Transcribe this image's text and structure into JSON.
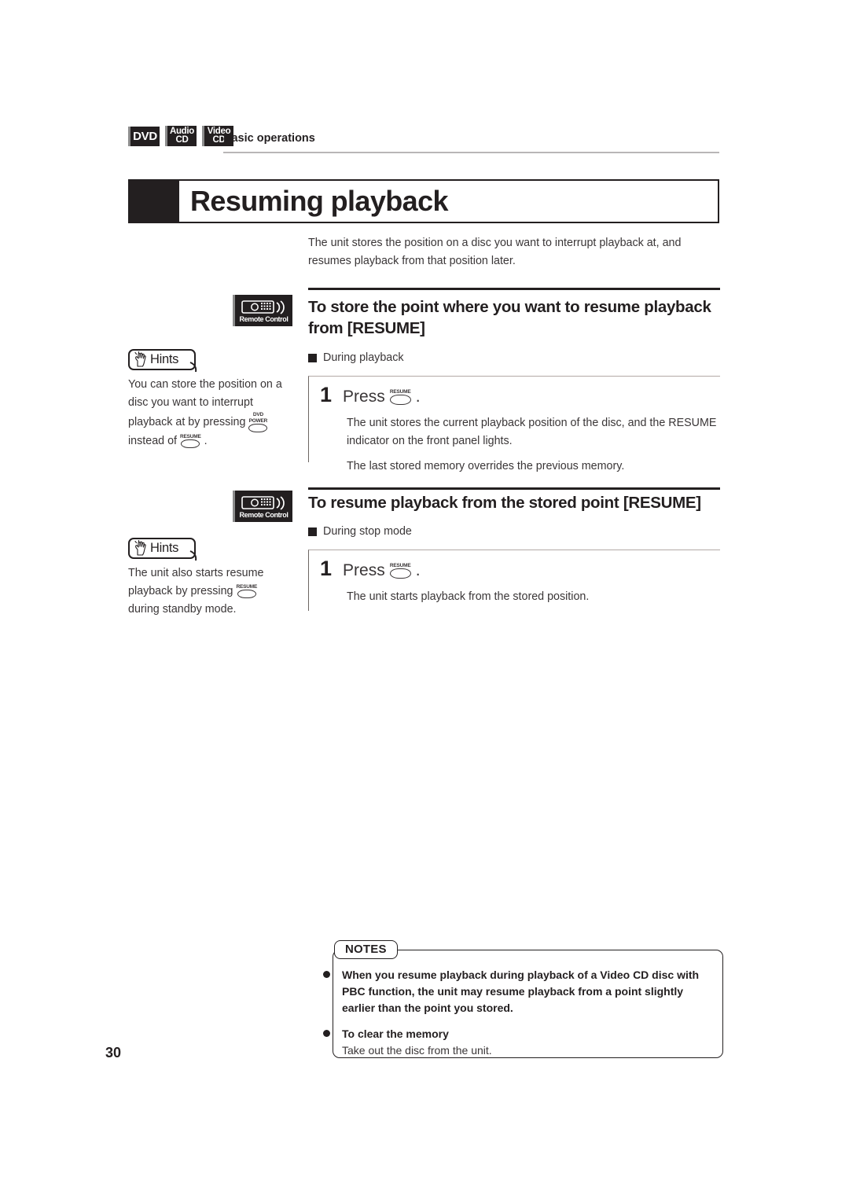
{
  "header": {
    "badges": [
      {
        "name": "dvd-badge",
        "line1": "DVD",
        "line2": ""
      },
      {
        "name": "audio-cd-badge",
        "line1": "Audio",
        "line2": "CD"
      },
      {
        "name": "video-cd-badge",
        "line1": "Video",
        "line2": "CD"
      }
    ],
    "title": "Basic operations"
  },
  "title_block": {
    "title": "Resuming playback"
  },
  "intro": "The unit stores the position on a disc you want to interrupt playback at, and resumes playback from that position later.",
  "sections": [
    {
      "icon_label": "Remote Control",
      "heading": "To store the point where you want to resume playback from [RESUME]",
      "mode": "During playback",
      "step": {
        "number": "1",
        "press_label": "Press",
        "button": "RESUME",
        "period": ".",
        "body": [
          "The unit stores the current playback position of the disc, and the RESUME indicator on the front panel lights.",
          "The last stored memory overrides the previous memory."
        ]
      },
      "hint": {
        "label": "Hints",
        "text_part1": "You can store the position on a disc you want to interrupt playback at by pressing",
        "button1_line1": "DVD",
        "button1_line2": "POWER",
        "text_part2": "instead of",
        "button2": "RESUME",
        "text_part3": "."
      }
    },
    {
      "icon_label": "Remote Control",
      "heading": "To resume playback from the stored point [RESUME]",
      "mode": "During stop mode",
      "step": {
        "number": "1",
        "press_label": "Press",
        "button": "RESUME",
        "period": ".",
        "body": [
          "The unit starts playback from the stored position."
        ]
      },
      "hint": {
        "label": "Hints",
        "text_part1": "The unit also starts resume playback by pressing",
        "button1_line1": "RESUME",
        "button1_line2": "",
        "text_part2": "during standby mode.",
        "button2": "",
        "text_part3": ""
      }
    }
  ],
  "notes": {
    "tab_label": "NOTES",
    "items": [
      {
        "bold_text": "When you resume playback during playback of a Video CD disc with PBC function, the unit may resume playback from a point slightly earlier than the point you stored.",
        "plain_text": ""
      },
      {
        "bold_text": "To clear the memory",
        "plain_text": "Take out the disc from the unit."
      }
    ]
  },
  "page_number": "30",
  "colors": {
    "ink": "#231f20",
    "body_text": "#3a3637",
    "rule": "#b9b6b7"
  }
}
